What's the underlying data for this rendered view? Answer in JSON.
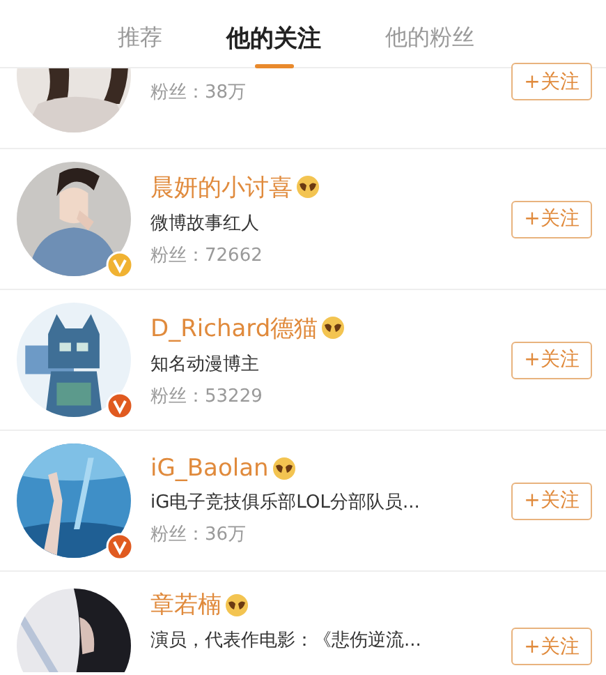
{
  "tabs": [
    {
      "label": "推荐",
      "selected": false
    },
    {
      "label": "他的关注",
      "selected": true
    },
    {
      "label": "他的粉丝",
      "selected": false
    }
  ],
  "users": [
    {
      "kind": "cut_top",
      "fans": "粉丝：38万",
      "follow": "+关注"
    },
    {
      "kind": "full",
      "name": "晨妍的小讨喜",
      "bio": "微博故事红人",
      "fans": "粉丝：72662",
      "follow": "+关注",
      "color": "#f0b232"
    },
    {
      "kind": "full",
      "name": "D_Richard德猫",
      "bio": "知名动漫博主",
      "fans": "粉丝：53229",
      "follow": "+关注",
      "color": "#e05a20"
    },
    {
      "kind": "full",
      "name": "iG_Baolan",
      "bio": "iG电子竞技俱乐部LOL分部队员...",
      "fans": "粉丝：36万",
      "follow": "+关注",
      "color": "#e05a20"
    },
    {
      "kind": "cut_bottom",
      "name": "章若楠",
      "bio": "演员，代表作电影：《悲伤逆流...",
      "follow": "+关注"
    }
  ]
}
